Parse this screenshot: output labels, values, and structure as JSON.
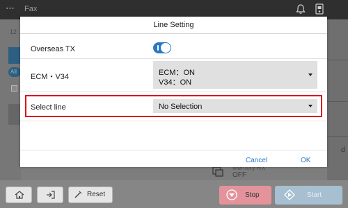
{
  "topbar": {
    "title": "Fax",
    "menu_icon": "more-icon",
    "icons": [
      "bell-icon",
      "device-status-icon"
    ]
  },
  "background": {
    "left_number": "12",
    "all_pill": "All",
    "right_letter": "d",
    "memory_line": "Memory RX",
    "memory_value": "OFF"
  },
  "dialog": {
    "title": "Line Setting",
    "rows": {
      "overseas": {
        "label": "Overseas TX",
        "state": "on"
      },
      "ecm": {
        "label": "ECM・V34",
        "value_line1": "ECM：ON",
        "value_line2": "V34：ON"
      },
      "line": {
        "label": "Select line",
        "value": "No Selection"
      }
    },
    "cancel_label": "Cancel",
    "ok_label": "OK",
    "accent_color": "#2a79c4",
    "highlight_color": "#d9141b"
  },
  "bottombar": {
    "reset_label": "Reset",
    "stop_label": "Stop",
    "start_label": "Start",
    "stop_color": "#e4939b",
    "start_color": "#a6bfd1"
  }
}
